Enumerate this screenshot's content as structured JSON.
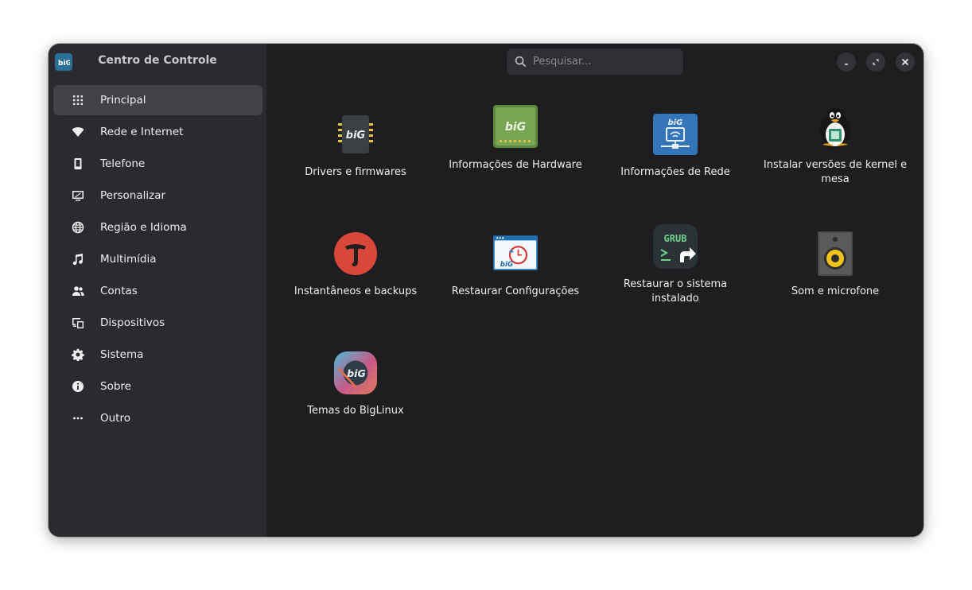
{
  "sidebar": {
    "title": "Centro de Controle",
    "items": [
      {
        "label": "Principal",
        "icon": "grid-icon",
        "active": true
      },
      {
        "label": "Rede e Internet",
        "icon": "wifi-icon"
      },
      {
        "label": "Telefone",
        "icon": "phone-icon"
      },
      {
        "label": "Personalizar",
        "icon": "display-brush-icon"
      },
      {
        "label": "Região e Idioma",
        "icon": "globe-icon"
      },
      {
        "label": "Multimídia",
        "icon": "music-note-icon"
      },
      {
        "label": "Contas",
        "icon": "users-icon"
      },
      {
        "label": "Dispositivos",
        "icon": "devices-icon"
      },
      {
        "label": "Sistema",
        "icon": "gear-icon"
      },
      {
        "label": "Sobre",
        "icon": "info-icon"
      },
      {
        "label": "Outro",
        "icon": "more-icon"
      }
    ]
  },
  "search": {
    "placeholder": "Pesquisar..."
  },
  "window_controls": {
    "minimize": "minimize-icon",
    "maximize": "maximize-icon",
    "close": "close-icon"
  },
  "tiles": [
    {
      "label": "Drivers e firmwares",
      "icon": "chip-icon"
    },
    {
      "label": "Informações de Hardware",
      "icon": "hardware-board-icon"
    },
    {
      "label": "Informações de Rede",
      "icon": "network-info-icon"
    },
    {
      "label": "Instalar versões de kernel e mesa",
      "icon": "tux-penguin-icon"
    },
    {
      "label": "Instantâneos e backups",
      "icon": "timeshift-icon"
    },
    {
      "label": "Restaurar Configurações",
      "icon": "restore-clock-icon"
    },
    {
      "label": "Restaurar o sistema instalado",
      "icon": "grub-icon"
    },
    {
      "label": "Som e microfone",
      "icon": "speaker-icon"
    },
    {
      "label": "Temas do BigLinux",
      "icon": "themes-icon"
    }
  ],
  "brand_text": {
    "big": "biG",
    "grub": "GRUB"
  },
  "colors": {
    "sidebar_bg": "#2b2b2f",
    "main_bg": "#1e1e20",
    "active_item_bg": "#414147",
    "text": "#f0f0f2"
  }
}
